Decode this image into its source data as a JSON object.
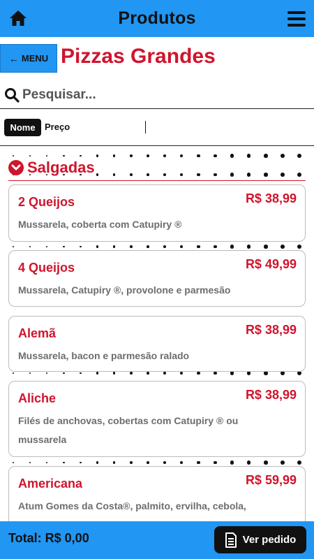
{
  "header": {
    "title": "Produtos",
    "home_icon": "home-icon",
    "menu_icon": "hamburger-icon"
  },
  "subheader": {
    "menu_label": "MENU",
    "back_icon": "arrow-left-icon",
    "page_title": "Pizzas Grandes"
  },
  "search": {
    "placeholder": "Pesquisar...",
    "value": "",
    "icon": "search-icon"
  },
  "sort": {
    "active": "Nome",
    "options": [
      "Nome",
      "Preço"
    ]
  },
  "category": {
    "label": "Salgadas",
    "icon": "chevron-down-circle-icon"
  },
  "products": [
    {
      "name": "2 Queijos",
      "price": "R$ 38,99",
      "description": "Mussarela, coberta com Catupiry ®"
    },
    {
      "name": "4 Queijos",
      "price": "R$ 49,99",
      "description": "Mussarela, Catupiry ®, provolone e parmesão"
    },
    {
      "name": "Alemã",
      "price": "R$ 38,99",
      "description": "Mussarela, bacon e parmesão ralado"
    },
    {
      "name": "Aliche",
      "price": "R$ 38,99",
      "description": "Filés de anchovas, cobertas com Catupiry ® ou mussarela"
    },
    {
      "name": "Americana",
      "price": "R$ 59,99",
      "description": "Atum Gomes da Costa®, palmito, ervilha, cebola, cobertos com mussarela"
    }
  ],
  "footer": {
    "total_label": "Total: R$ 0,00",
    "order_button": "Ver pedido",
    "order_icon": "document-icon"
  },
  "colors": {
    "primary": "#2196f3",
    "accent": "#d0142c",
    "text_muted": "#6d6d6d",
    "dark": "#111111"
  }
}
